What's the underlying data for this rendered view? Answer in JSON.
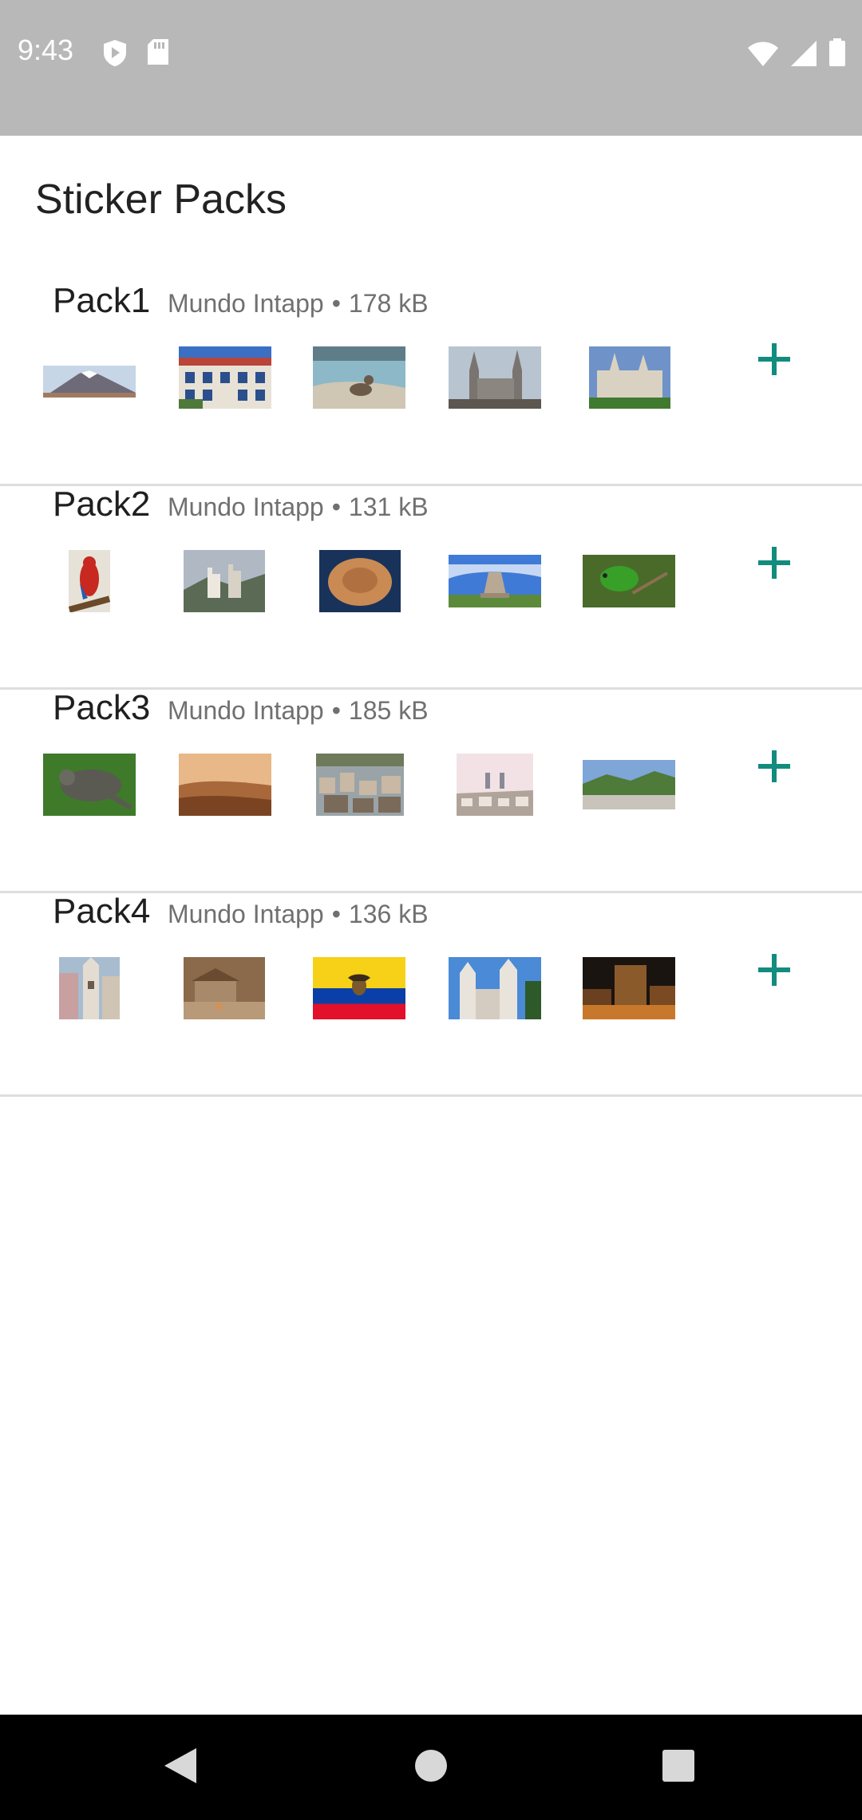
{
  "status_bar": {
    "time": "9:43",
    "icons": [
      "shield-icon",
      "sd-card-icon",
      "wifi-icon",
      "signal-icon",
      "battery-icon"
    ]
  },
  "header": {
    "title": "Sticker Packs"
  },
  "packs": [
    {
      "name": "Pack1",
      "author": "Mundo Intapp",
      "separator": "•",
      "size": "178 kB"
    },
    {
      "name": "Pack2",
      "author": "Mundo Intapp",
      "separator": "•",
      "size": "131 kB"
    },
    {
      "name": "Pack3",
      "author": "Mundo Intapp",
      "separator": "•",
      "size": "185 kB"
    },
    {
      "name": "Pack4",
      "author": "Mundo Intapp",
      "separator": "•",
      "size": "136 kB"
    }
  ],
  "colors": {
    "accent": "#128c7e",
    "status_bar": "#b8b8b8",
    "nav_bar": "#000000"
  },
  "nav": {
    "icons": [
      "back-icon",
      "home-icon",
      "recents-icon"
    ]
  }
}
